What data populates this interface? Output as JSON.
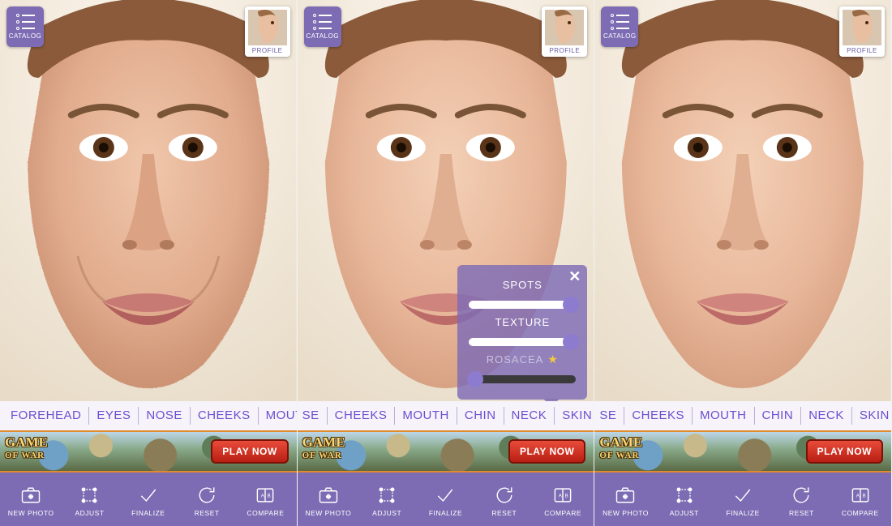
{
  "colors": {
    "primary": "#7d6cb3",
    "accent": "#6a4ecf"
  },
  "catalog_label": "CATALOG",
  "profile_label": "PROFILE",
  "ad": {
    "title_top": "GAME",
    "title_bot": "OF WAR",
    "cta": "PLAY NOW"
  },
  "toolbar": {
    "new_photo": "NEW PHOTO",
    "adjust": "ADJUST",
    "finalize": "FINALIZE",
    "reset": "RESET",
    "compare": "COMPARE"
  },
  "panels": [
    {
      "tabs": [
        "FOREHEAD",
        "EYES",
        "NOSE",
        "CHEEKS",
        "MOUTH"
      ],
      "smooth": false
    },
    {
      "tabs_partial_first": "SE",
      "tabs": [
        "CHEEKS",
        "MOUTH",
        "CHIN",
        "NECK",
        "SKIN"
      ],
      "smooth": true,
      "popup": {
        "sliders": [
          {
            "label": "SPOTS",
            "value": 100,
            "track": "light",
            "disabled": false
          },
          {
            "label": "TEXTURE",
            "value": 100,
            "track": "light",
            "disabled": false
          },
          {
            "label": "ROSACEA",
            "value": 0,
            "track": "dark",
            "disabled": true,
            "star": true
          }
        ]
      }
    },
    {
      "tabs_partial_first": "SE",
      "tabs": [
        "CHEEKS",
        "MOUTH",
        "CHIN",
        "NECK",
        "SKIN"
      ],
      "smooth": true
    }
  ]
}
